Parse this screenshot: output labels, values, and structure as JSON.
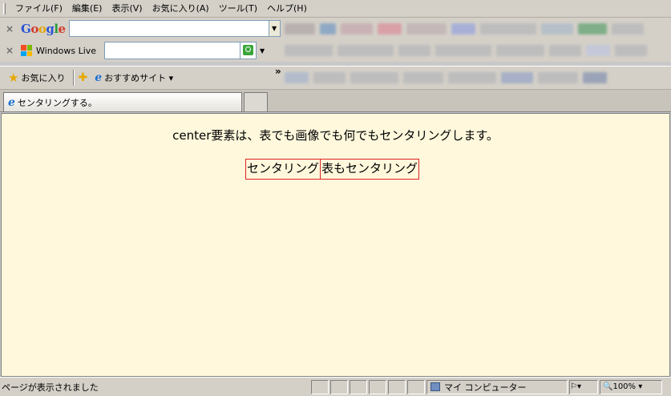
{
  "menu": [
    "ファイル(F)",
    "編集(E)",
    "表示(V)",
    "お気に入り(A)",
    "ツール(T)",
    "ヘルプ(H)"
  ],
  "toolbar_google": {
    "close_icon": "×",
    "logo": [
      "G",
      "o",
      "o",
      "g",
      "l",
      "e"
    ]
  },
  "toolbar_live": {
    "close_icon": "×",
    "label": "Windows Live"
  },
  "favorites_bar": {
    "favorites_label": "お気に入り",
    "suggested_label": "おすすめサイト ▾",
    "chevron": "»"
  },
  "tab": {
    "title": "センタリングする。",
    "new_tab": ""
  },
  "content": {
    "paragraph": "center要素は、表でも画像でも何でもセンタリングします。",
    "table_cells": [
      "センタリング",
      "表もセンタリング"
    ],
    "background": "#fff8dc",
    "border_color": "#dd2222"
  },
  "status": {
    "text": "ページが表示されました",
    "zone": "マイ コンピューター",
    "zoom": "100%"
  }
}
